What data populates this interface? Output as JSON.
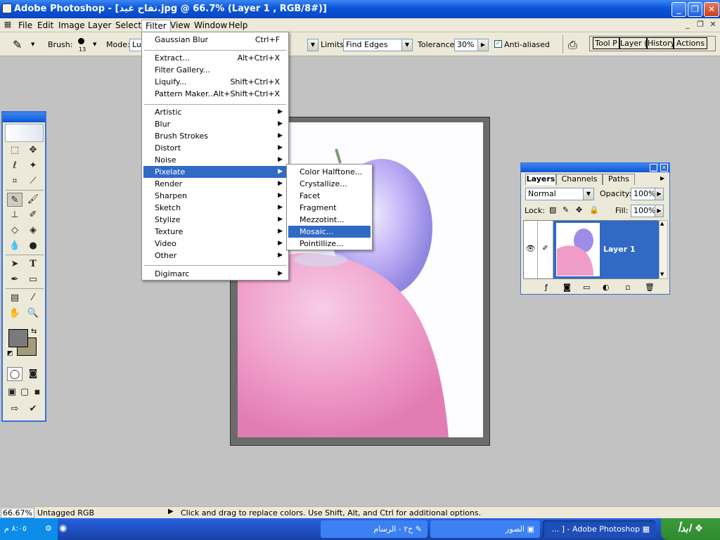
{
  "window": {
    "title": "Adobe Photoshop - [تفاح غيد.jpg @ 66.7% (Layer 1 , RGB/8#)]"
  },
  "menubar": {
    "items": [
      "File",
      "Edit",
      "Image",
      "Layer",
      "Select",
      "Filter",
      "View",
      "Window",
      "Help"
    ]
  },
  "options_bar": {
    "brush_label": "Brush:",
    "brush_size": "13",
    "mode_label": "Mode:",
    "mode_value": "Lu",
    "limits_label": "Limits:",
    "limits_value": "Find Edges",
    "tolerance_label": "Tolerance:",
    "tolerance_value": "30%",
    "antialias_label": "Anti-aliased",
    "antialias_checked": true,
    "palette_tabs": [
      "Tool P",
      "Layer (",
      "History",
      "Actions"
    ]
  },
  "filter_menu": {
    "groups": [
      [
        {
          "label": "Gaussian Blur",
          "shortcut": "Ctrl+F"
        }
      ],
      [
        {
          "label": "Extract...",
          "shortcut": "Alt+Ctrl+X"
        },
        {
          "label": "Filter Gallery...",
          "shortcut": ""
        },
        {
          "label": "Liquify...",
          "shortcut": "Shift+Ctrl+X"
        },
        {
          "label": "Pattern Maker...",
          "shortcut": "Alt+Shift+Ctrl+X"
        }
      ],
      [
        {
          "label": "Artistic",
          "submenu": true
        },
        {
          "label": "Blur",
          "submenu": true
        },
        {
          "label": "Brush Strokes",
          "submenu": true
        },
        {
          "label": "Distort",
          "submenu": true
        },
        {
          "label": "Noise",
          "submenu": true
        },
        {
          "label": "Pixelate",
          "submenu": true,
          "highlighted": true
        },
        {
          "label": "Render",
          "submenu": true
        },
        {
          "label": "Sharpen",
          "submenu": true
        },
        {
          "label": "Sketch",
          "submenu": true
        },
        {
          "label": "Stylize",
          "submenu": true
        },
        {
          "label": "Texture",
          "submenu": true
        },
        {
          "label": "Video",
          "submenu": true
        },
        {
          "label": "Other",
          "submenu": true
        }
      ],
      [
        {
          "label": "Digimarc",
          "submenu": true
        }
      ]
    ]
  },
  "pixelate_submenu": {
    "items": [
      {
        "label": "Color Halftone..."
      },
      {
        "label": "Crystallize..."
      },
      {
        "label": "Facet"
      },
      {
        "label": "Fragment"
      },
      {
        "label": "Mezzotint..."
      },
      {
        "label": "Mosaic...",
        "highlighted": true
      },
      {
        "label": "Pointillize..."
      }
    ]
  },
  "layers_panel": {
    "tabs": [
      "Layers",
      "Channels",
      "Paths"
    ],
    "blend_mode": "Normal",
    "opacity_label": "Opacity:",
    "opacity_value": "100%",
    "lock_label": "Lock:",
    "fill_label": "Fill:",
    "fill_value": "100%",
    "layer_name": "Layer 1"
  },
  "status_bar": {
    "zoom": "66.67%",
    "profile": "Untagged RGB",
    "hint": "Click and drag to replace colors.  Use Shift, Alt, and Ctrl for additional options."
  },
  "taskbar": {
    "clock": "٨:٠٥ م",
    "tasks": [
      "... ] - Adobe Photoshop",
      "الصور",
      "خ٢ - الرسام"
    ],
    "start_label": "ابدأ"
  },
  "colors": {
    "accent": "#316ac5",
    "title_blue": "#0a55d8",
    "foreground_swatch": "#7a7a7a",
    "background_swatch": "#a39c7a"
  }
}
